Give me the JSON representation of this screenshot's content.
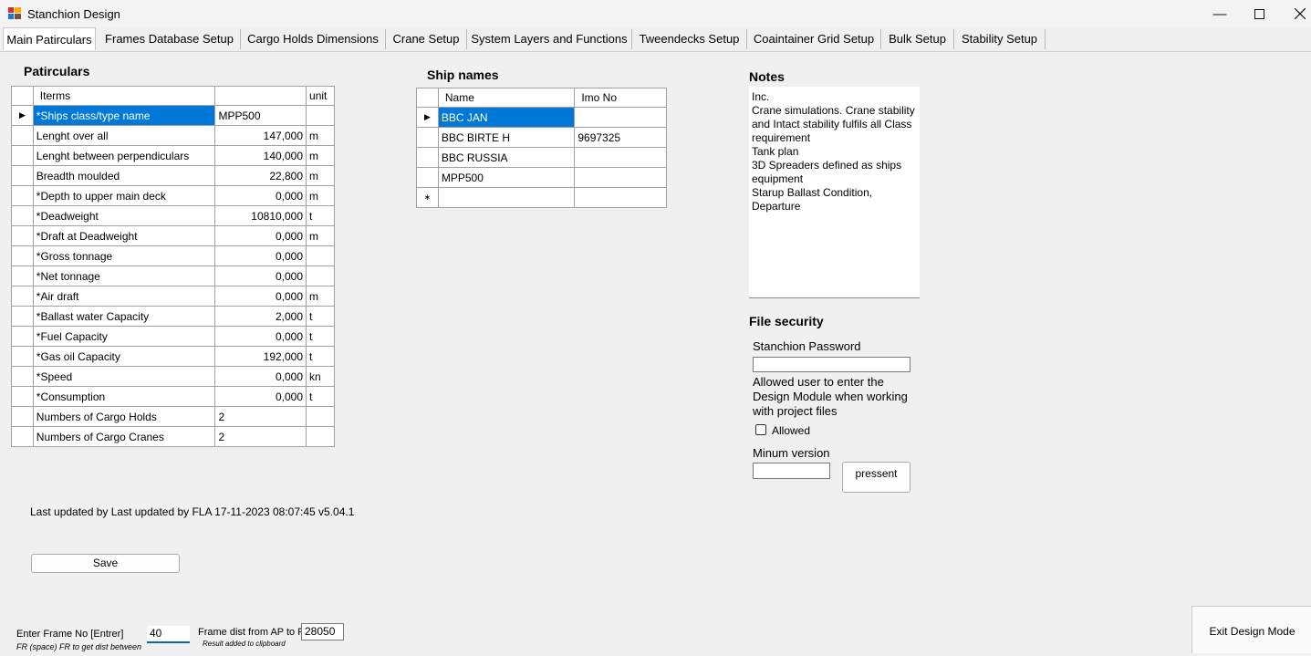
{
  "window": {
    "title": "Stanchion Design"
  },
  "tabs": [
    {
      "label": "Main Patirculars",
      "active": true
    },
    {
      "label": "Frames Database Setup"
    },
    {
      "label": "Cargo Holds Dimensions"
    },
    {
      "label": "Crane Setup"
    },
    {
      "label": "System Layers and Functions"
    },
    {
      "label": "Tweendecks Setup"
    },
    {
      "label": "Coaintainer Grid Setup"
    },
    {
      "label": "Bulk Setup"
    },
    {
      "label": "Stability Setup"
    }
  ],
  "particulars": {
    "title": "Patirculars",
    "headers": {
      "item": "Iterms",
      "value": "",
      "unit": "unit"
    },
    "rows": [
      {
        "item": "*Ships class/type name",
        "value": "MPP500",
        "unit": ""
      },
      {
        "item": "Lenght over all",
        "value": "147,000",
        "unit": "m"
      },
      {
        "item": "Lenght between perpendiculars",
        "value": "140,000",
        "unit": "m"
      },
      {
        "item": "Breadth moulded",
        "value": "22,800",
        "unit": "m"
      },
      {
        "item": "*Depth to upper main deck",
        "value": "0,000",
        "unit": "m"
      },
      {
        "item": "*Deadweight",
        "value": "10810,000",
        "unit": "t"
      },
      {
        "item": "*Draft at Deadweight",
        "value": "0,000",
        "unit": "m"
      },
      {
        "item": "*Gross tonnage",
        "value": "0,000",
        "unit": ""
      },
      {
        "item": "*Net tonnage",
        "value": "0,000",
        "unit": ""
      },
      {
        "item": "*Air draft",
        "value": "0,000",
        "unit": "m"
      },
      {
        "item": "*Ballast water Capacity",
        "value": "2,000",
        "unit": "t"
      },
      {
        "item": "*Fuel Capacity",
        "value": "0,000",
        "unit": "t"
      },
      {
        "item": "*Gas oil Capacity",
        "value": "192,000",
        "unit": "t"
      },
      {
        "item": "*Speed",
        "value": "0,000",
        "unit": "kn"
      },
      {
        "item": "*Consumption",
        "value": "0,000",
        "unit": "t"
      },
      {
        "item": "Numbers of Cargo Holds",
        "value": "2",
        "unit": ""
      },
      {
        "item": "Numbers of Cargo Cranes",
        "value": "2",
        "unit": ""
      }
    ]
  },
  "ship_names": {
    "title": "Ship names",
    "headers": {
      "name": "Name",
      "imo": "Imo No"
    },
    "rows": [
      {
        "name": "BBC JAN",
        "imo": ""
      },
      {
        "name": "BBC BIRTE H",
        "imo": "9697325"
      },
      {
        "name": "BBC RUSSIA",
        "imo": ""
      },
      {
        "name": "MPP500",
        "imo": ""
      }
    ]
  },
  "notes": {
    "title": "Notes",
    "text": "Inc.\nCrane simulations. Crane stability and Intact stability fulfils all Class requirement\nTank plan\n3D Spreaders defined as ships equipment\nStarup Ballast Condition, Departure"
  },
  "file_security": {
    "title": "File security",
    "password_label": "Stanchion Password",
    "password_value": "",
    "allowed_description": "Allowed user to enter the Design Module when working with project files",
    "allowed_label": "Allowed",
    "allowed_checked": false,
    "min_version_label": "Minum version",
    "min_version_value": "",
    "present_button": "pressent"
  },
  "last_updated": "Last updated by Last updated by FLA 17-11-2023 08:07:45 v5.04.1",
  "save_button": "Save",
  "frame_tools": {
    "enter_frame_label": "Enter Frame No [Entrer]",
    "enter_frame_hint": "FR (space) FR to get dist between",
    "frame_value": "40",
    "dist_label": "Frame dist from AP to Fr",
    "dist_value": "28050",
    "dist_hint": "Result  added to clipboard"
  },
  "exit_button": "Exit Design Mode"
}
